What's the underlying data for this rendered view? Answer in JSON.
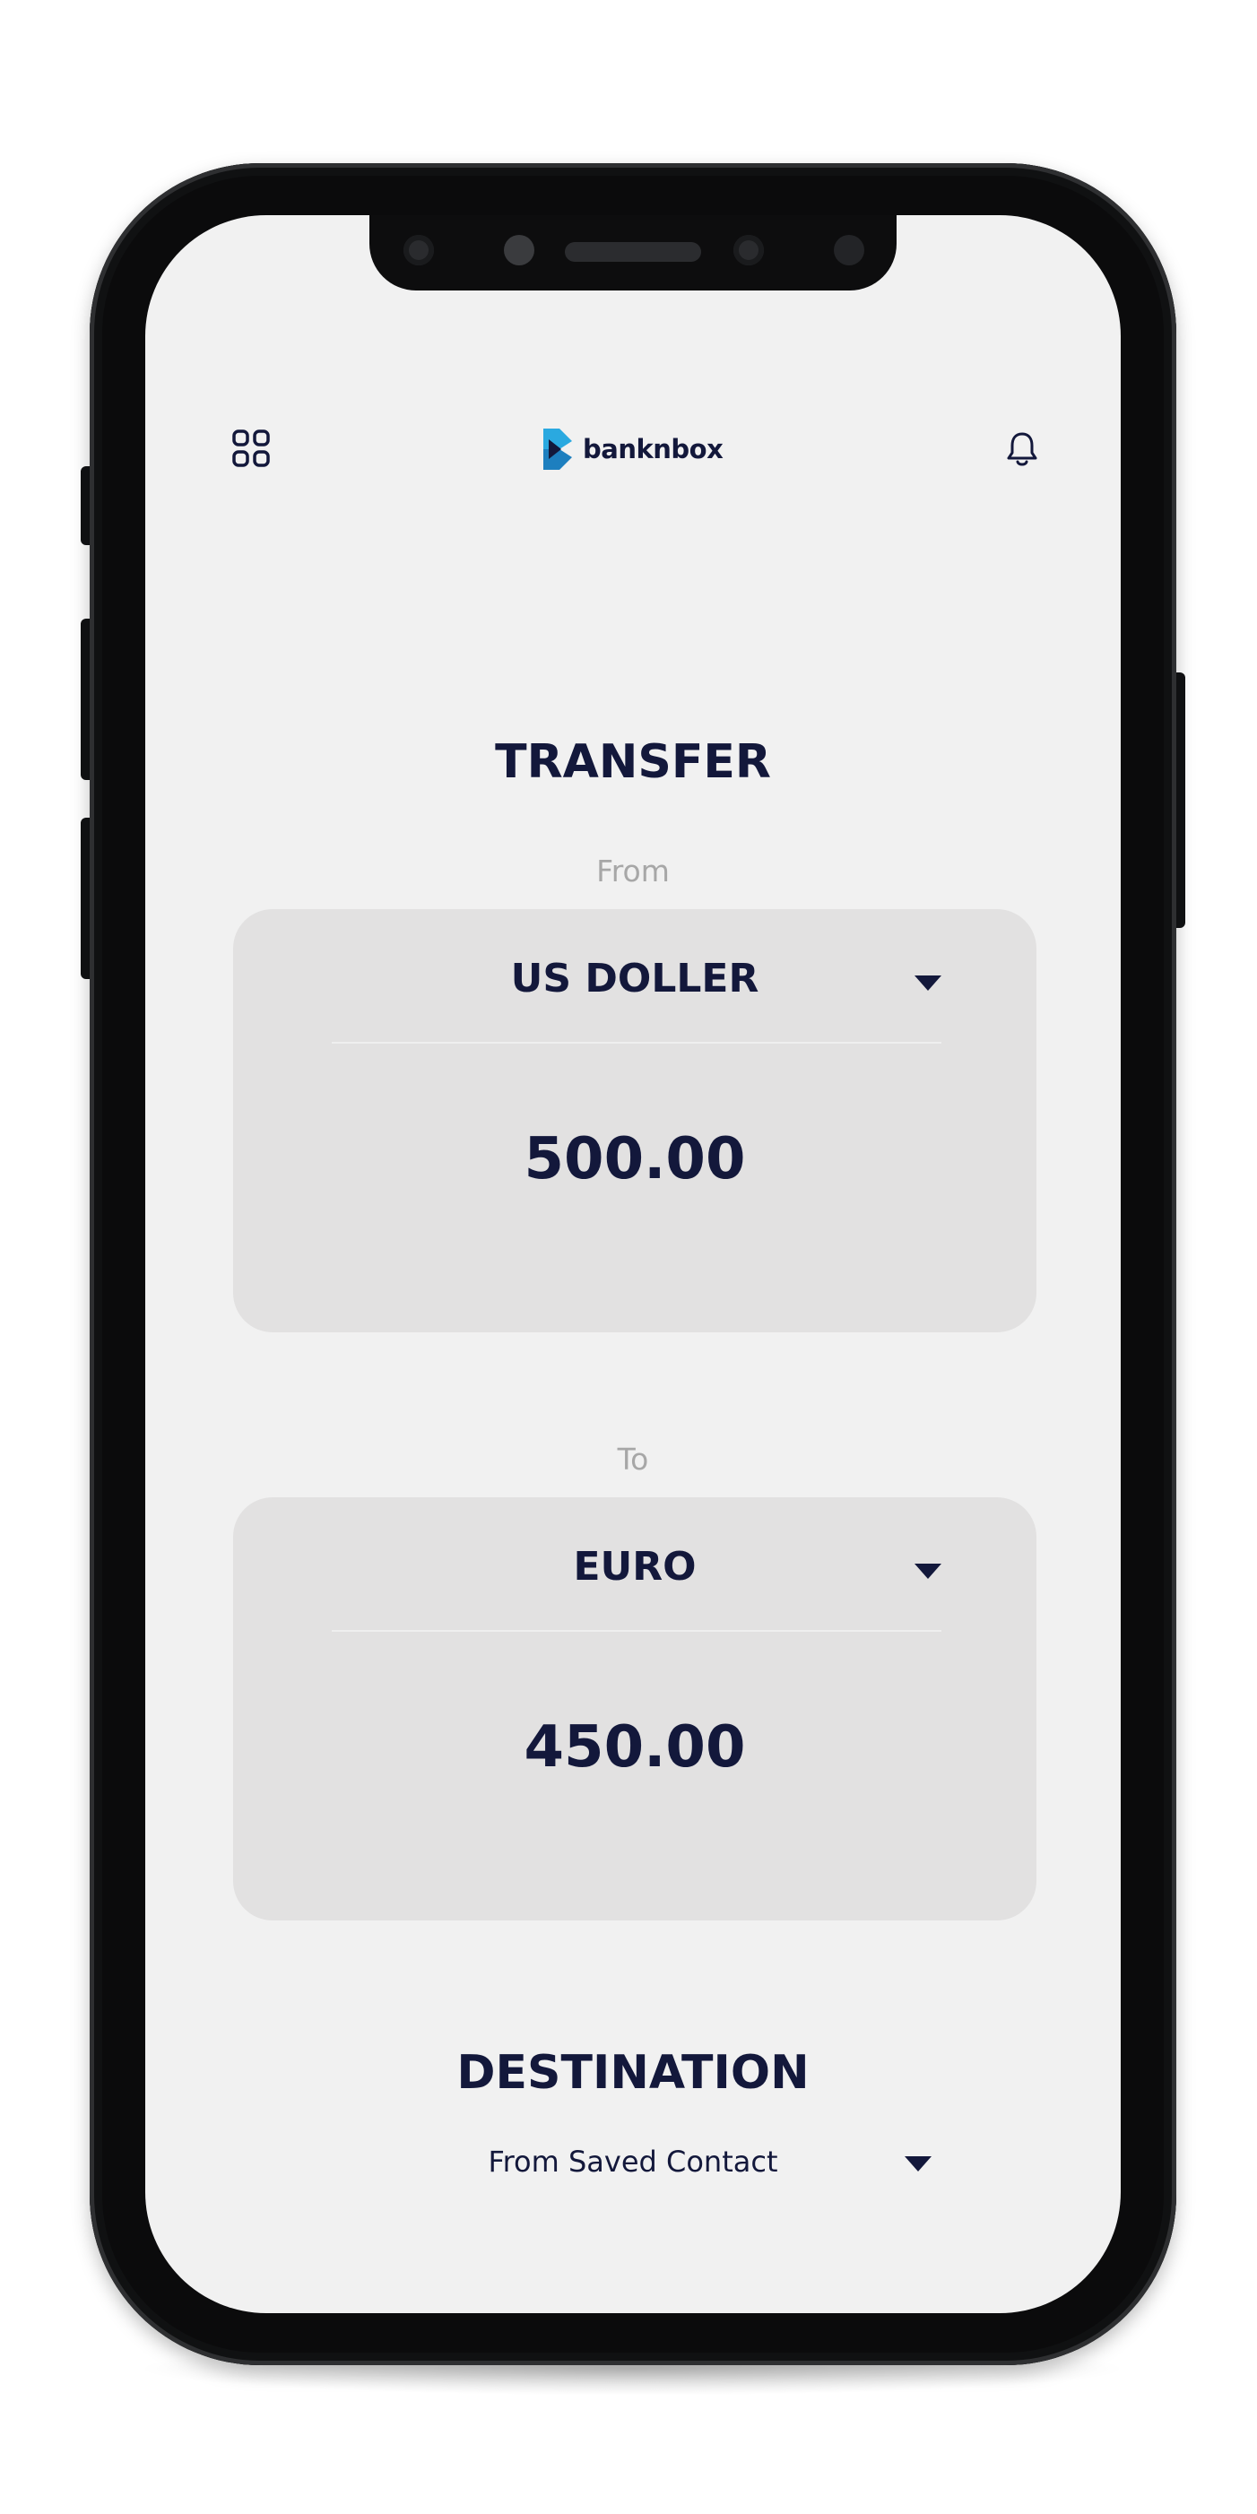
{
  "header": {
    "brand_name": "banknbox",
    "menu_icon": "grid-icon",
    "notification_icon": "bell-icon",
    "brand_colors": {
      "primary": "#2aa9e0",
      "dark": "#13183b"
    }
  },
  "transfer": {
    "title": "TRANSFER",
    "from": {
      "label": "From",
      "currency": "US DOLLER",
      "amount": "500.00"
    },
    "to": {
      "label": "To",
      "currency": "EURO",
      "amount": "450.00"
    }
  },
  "destination": {
    "title": "DESTINATION",
    "selected": "From Saved Contact"
  },
  "theme": {
    "text": "#13183b",
    "muted": "#a7a7a7",
    "card": "#e2e1e1",
    "screen": "#f1f1f1"
  }
}
